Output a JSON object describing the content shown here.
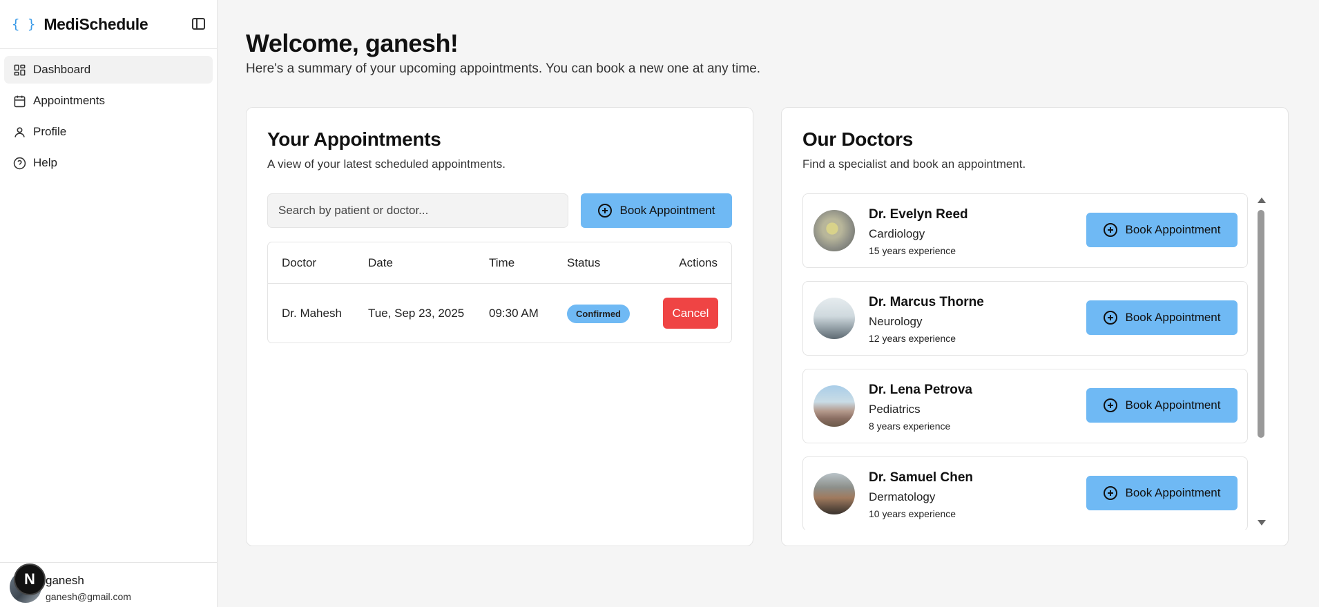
{
  "app": {
    "brand_icon": "{ }",
    "title": "MediSchedule"
  },
  "sidebar": {
    "items": [
      {
        "label": "Dashboard",
        "icon": "dashboard-icon",
        "active": true
      },
      {
        "label": "Appointments",
        "icon": "calendar-icon",
        "active": false
      },
      {
        "label": "Profile",
        "icon": "user-icon",
        "active": false
      },
      {
        "label": "Help",
        "icon": "help-circle-icon",
        "active": false
      }
    ]
  },
  "user": {
    "initial": "N",
    "name": "ganesh",
    "email": "ganesh@gmail.com"
  },
  "header": {
    "welcome": "Welcome, ganesh!",
    "subtitle": "Here's a summary of your upcoming appointments. You can book a new one at any time."
  },
  "appointments": {
    "title": "Your Appointments",
    "subtitle": "A view of your latest scheduled appointments.",
    "search_placeholder": "Search by patient or doctor...",
    "book_label": "Book Appointment",
    "columns": [
      "Doctor",
      "Date",
      "Time",
      "Status",
      "Actions"
    ],
    "rows": [
      {
        "doctor": "Dr. Mahesh",
        "date": "Tue, Sep 23, 2025",
        "time": "09:30 AM",
        "status": "Confirmed",
        "action": "Cancel"
      }
    ]
  },
  "doctors": {
    "title": "Our Doctors",
    "subtitle": "Find a specialist and book an appointment.",
    "book_label": "Book Appointment",
    "list": [
      {
        "name": "Dr. Evelyn Reed",
        "specialty": "Cardiology",
        "experience": "15 years experience"
      },
      {
        "name": "Dr. Marcus Thorne",
        "specialty": "Neurology",
        "experience": "12 years experience"
      },
      {
        "name": "Dr. Lena Petrova",
        "specialty": "Pediatrics",
        "experience": "8 years experience"
      },
      {
        "name": "Dr. Samuel Chen",
        "specialty": "Dermatology",
        "experience": "10 years experience"
      }
    ]
  },
  "colors": {
    "accent": "#6fb9f4",
    "danger": "#ef4444",
    "brand_icon": "#3b9be8"
  }
}
